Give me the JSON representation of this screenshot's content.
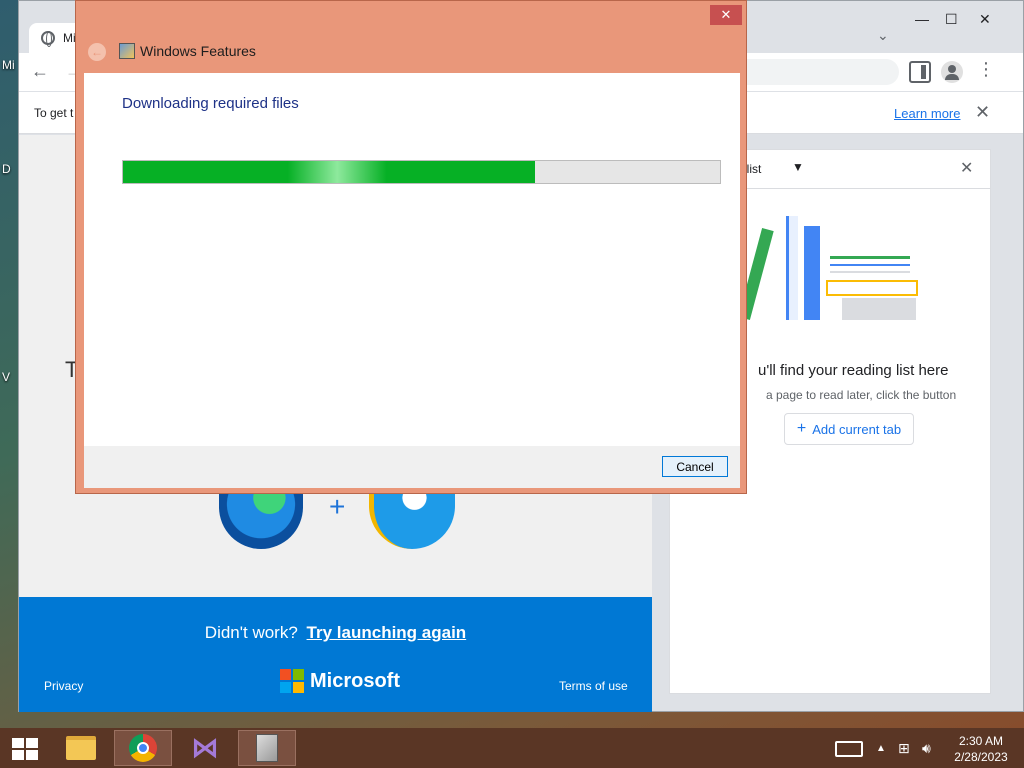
{
  "desktop": {
    "fragments": [
      "Mi",
      "D",
      "V"
    ]
  },
  "browser": {
    "tab_title": "Mi",
    "infobar": {
      "text": "To get t",
      "learn_more": "Learn more"
    },
    "page": {
      "heading_fragment": "T",
      "didnt_work": "Didn't work?",
      "try_again": "Try launching again",
      "privacy": "Privacy",
      "brand": "Microsoft",
      "terms": "Terms of use"
    },
    "reading_list": {
      "title": "ng list",
      "heading": "u'll find your reading list here",
      "subtext": "a page to read later, click the button",
      "add_button": "Add current tab"
    }
  },
  "dialog": {
    "title": "Windows Features",
    "heading": "Downloading required files",
    "progress_fraction": 0.69,
    "cancel_label": "Cancel",
    "close_glyph": "✕"
  },
  "taskbar": {
    "time": "2:30 AM",
    "date": "2/28/2023"
  },
  "colors": {
    "dialog_frame": "#e9977a",
    "progress_green": "#06b025",
    "edge_blue": "#0078d4",
    "link_blue": "#1a73e8"
  }
}
